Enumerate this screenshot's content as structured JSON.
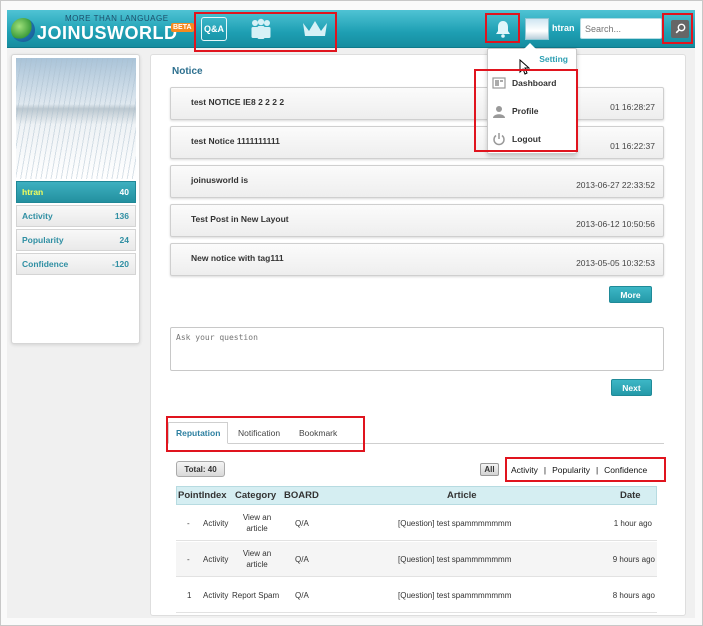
{
  "header": {
    "logo_tagline": "MORE THAN LANGUAGE",
    "logo_text": "JOINUSWORLD",
    "beta_badge": "BETA",
    "nav": [
      {
        "label": "Q&A",
        "icon": "qa-icon"
      },
      {
        "icon": "people-icon"
      },
      {
        "icon": "crown-icon"
      }
    ],
    "user_name": "htran",
    "search_placeholder": "Search..."
  },
  "dropdown": {
    "title": "Setting",
    "items": [
      {
        "label": "Dashboard",
        "icon": "dashboard-icon"
      },
      {
        "label": "Profile",
        "icon": "profile-icon"
      },
      {
        "label": "Logout",
        "icon": "power-icon"
      }
    ]
  },
  "sidebar": {
    "stats": [
      {
        "label": "htran",
        "value": "40"
      },
      {
        "label": "Activity",
        "value": "136"
      },
      {
        "label": "Popularity",
        "value": "24"
      },
      {
        "label": "Confidence",
        "value": "-120"
      }
    ]
  },
  "notice": {
    "title": "Notice",
    "items": [
      {
        "text": "test NOTICE IE8 2 2 2 2",
        "date": "01 16:28:27"
      },
      {
        "text": "test Notice 1111111111",
        "date": "01 16:22:37"
      },
      {
        "text": "joinusworld is",
        "date": "2013-06-27 22:33:52"
      },
      {
        "text": "Test Post in New Layout",
        "date": "2013-06-12 10:50:56"
      },
      {
        "text": "New notice with tag111",
        "date": "2013-05-05 10:32:53"
      }
    ],
    "more_label": "More"
  },
  "question": {
    "placeholder": "Ask your question",
    "next_label": "Next"
  },
  "tabs": [
    {
      "label": "Reputation",
      "active": true
    },
    {
      "label": "Notification",
      "active": false
    },
    {
      "label": "Bookmark",
      "active": false
    }
  ],
  "reputation": {
    "total_label": "Total: 40",
    "all_label": "All",
    "filters": [
      "Activity",
      "Popularity",
      "Confidence"
    ],
    "filter_separator": "|",
    "columns": [
      "PointIndex",
      "Category",
      "BOARD",
      "Article",
      "Date"
    ],
    "rows": [
      {
        "point": "-",
        "category": "Activity",
        "action": "View an article",
        "board": "Q/A",
        "article": "[Question] test spammmmmmm",
        "date": "1 hour ago"
      },
      {
        "point": "-",
        "category": "Activity",
        "action": "View an article",
        "board": "Q/A",
        "article": "[Question] test spammmmmmm",
        "date": "9 hours ago"
      },
      {
        "point": "1",
        "category": "Activity",
        "action": "Report Spam",
        "board": "Q/A",
        "article": "[Question] test spammmmmmm",
        "date": "8 hours ago"
      }
    ]
  },
  "colors": {
    "accent": "#1e9fb3",
    "highlight": "#e0141e",
    "link": "#2c6f8e"
  }
}
